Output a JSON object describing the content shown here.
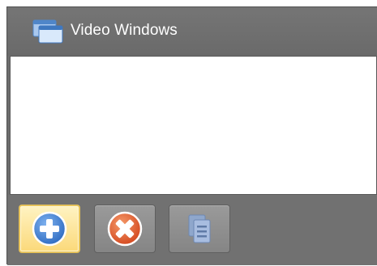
{
  "panel": {
    "title": "Video Windows",
    "title_icon": "windows-stack-icon",
    "list_items": []
  },
  "toolbar": {
    "buttons": [
      {
        "name": "add",
        "icon": "plus-circle-icon",
        "state": "hovered",
        "accent": "#3a78c9"
      },
      {
        "name": "remove",
        "icon": "x-circle-icon",
        "state": "normal",
        "accent": "#e0562a"
      },
      {
        "name": "list",
        "icon": "list-pages-icon",
        "state": "disabled",
        "accent": "#7f9cc7"
      }
    ]
  },
  "colors": {
    "panel_bg": "#6e6e6e",
    "list_bg": "#ffffff",
    "hover_btn": "#fbd97a"
  }
}
